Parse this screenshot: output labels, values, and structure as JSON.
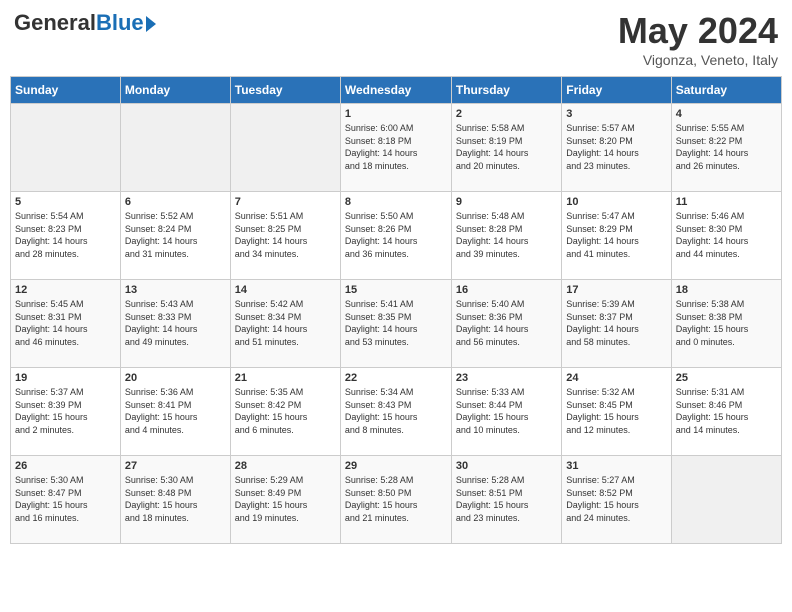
{
  "header": {
    "logo_general": "General",
    "logo_blue": "Blue",
    "month": "May 2024",
    "location": "Vigonza, Veneto, Italy"
  },
  "days_of_week": [
    "Sunday",
    "Monday",
    "Tuesday",
    "Wednesday",
    "Thursday",
    "Friday",
    "Saturday"
  ],
  "weeks": [
    [
      {
        "num": "",
        "info": ""
      },
      {
        "num": "",
        "info": ""
      },
      {
        "num": "",
        "info": ""
      },
      {
        "num": "1",
        "info": "Sunrise: 6:00 AM\nSunset: 8:18 PM\nDaylight: 14 hours\nand 18 minutes."
      },
      {
        "num": "2",
        "info": "Sunrise: 5:58 AM\nSunset: 8:19 PM\nDaylight: 14 hours\nand 20 minutes."
      },
      {
        "num": "3",
        "info": "Sunrise: 5:57 AM\nSunset: 8:20 PM\nDaylight: 14 hours\nand 23 minutes."
      },
      {
        "num": "4",
        "info": "Sunrise: 5:55 AM\nSunset: 8:22 PM\nDaylight: 14 hours\nand 26 minutes."
      }
    ],
    [
      {
        "num": "5",
        "info": "Sunrise: 5:54 AM\nSunset: 8:23 PM\nDaylight: 14 hours\nand 28 minutes."
      },
      {
        "num": "6",
        "info": "Sunrise: 5:52 AM\nSunset: 8:24 PM\nDaylight: 14 hours\nand 31 minutes."
      },
      {
        "num": "7",
        "info": "Sunrise: 5:51 AM\nSunset: 8:25 PM\nDaylight: 14 hours\nand 34 minutes."
      },
      {
        "num": "8",
        "info": "Sunrise: 5:50 AM\nSunset: 8:26 PM\nDaylight: 14 hours\nand 36 minutes."
      },
      {
        "num": "9",
        "info": "Sunrise: 5:48 AM\nSunset: 8:28 PM\nDaylight: 14 hours\nand 39 minutes."
      },
      {
        "num": "10",
        "info": "Sunrise: 5:47 AM\nSunset: 8:29 PM\nDaylight: 14 hours\nand 41 minutes."
      },
      {
        "num": "11",
        "info": "Sunrise: 5:46 AM\nSunset: 8:30 PM\nDaylight: 14 hours\nand 44 minutes."
      }
    ],
    [
      {
        "num": "12",
        "info": "Sunrise: 5:45 AM\nSunset: 8:31 PM\nDaylight: 14 hours\nand 46 minutes."
      },
      {
        "num": "13",
        "info": "Sunrise: 5:43 AM\nSunset: 8:33 PM\nDaylight: 14 hours\nand 49 minutes."
      },
      {
        "num": "14",
        "info": "Sunrise: 5:42 AM\nSunset: 8:34 PM\nDaylight: 14 hours\nand 51 minutes."
      },
      {
        "num": "15",
        "info": "Sunrise: 5:41 AM\nSunset: 8:35 PM\nDaylight: 14 hours\nand 53 minutes."
      },
      {
        "num": "16",
        "info": "Sunrise: 5:40 AM\nSunset: 8:36 PM\nDaylight: 14 hours\nand 56 minutes."
      },
      {
        "num": "17",
        "info": "Sunrise: 5:39 AM\nSunset: 8:37 PM\nDaylight: 14 hours\nand 58 minutes."
      },
      {
        "num": "18",
        "info": "Sunrise: 5:38 AM\nSunset: 8:38 PM\nDaylight: 15 hours\nand 0 minutes."
      }
    ],
    [
      {
        "num": "19",
        "info": "Sunrise: 5:37 AM\nSunset: 8:39 PM\nDaylight: 15 hours\nand 2 minutes."
      },
      {
        "num": "20",
        "info": "Sunrise: 5:36 AM\nSunset: 8:41 PM\nDaylight: 15 hours\nand 4 minutes."
      },
      {
        "num": "21",
        "info": "Sunrise: 5:35 AM\nSunset: 8:42 PM\nDaylight: 15 hours\nand 6 minutes."
      },
      {
        "num": "22",
        "info": "Sunrise: 5:34 AM\nSunset: 8:43 PM\nDaylight: 15 hours\nand 8 minutes."
      },
      {
        "num": "23",
        "info": "Sunrise: 5:33 AM\nSunset: 8:44 PM\nDaylight: 15 hours\nand 10 minutes."
      },
      {
        "num": "24",
        "info": "Sunrise: 5:32 AM\nSunset: 8:45 PM\nDaylight: 15 hours\nand 12 minutes."
      },
      {
        "num": "25",
        "info": "Sunrise: 5:31 AM\nSunset: 8:46 PM\nDaylight: 15 hours\nand 14 minutes."
      }
    ],
    [
      {
        "num": "26",
        "info": "Sunrise: 5:30 AM\nSunset: 8:47 PM\nDaylight: 15 hours\nand 16 minutes."
      },
      {
        "num": "27",
        "info": "Sunrise: 5:30 AM\nSunset: 8:48 PM\nDaylight: 15 hours\nand 18 minutes."
      },
      {
        "num": "28",
        "info": "Sunrise: 5:29 AM\nSunset: 8:49 PM\nDaylight: 15 hours\nand 19 minutes."
      },
      {
        "num": "29",
        "info": "Sunrise: 5:28 AM\nSunset: 8:50 PM\nDaylight: 15 hours\nand 21 minutes."
      },
      {
        "num": "30",
        "info": "Sunrise: 5:28 AM\nSunset: 8:51 PM\nDaylight: 15 hours\nand 23 minutes."
      },
      {
        "num": "31",
        "info": "Sunrise: 5:27 AM\nSunset: 8:52 PM\nDaylight: 15 hours\nand 24 minutes."
      },
      {
        "num": "",
        "info": ""
      }
    ]
  ]
}
